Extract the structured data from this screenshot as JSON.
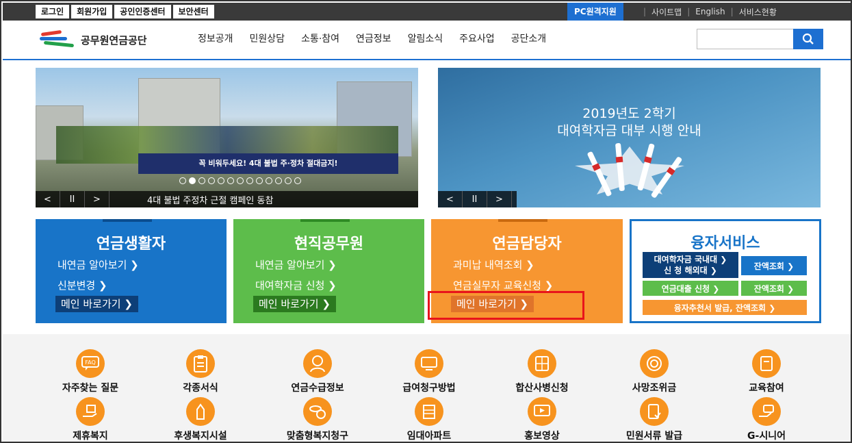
{
  "topbar": {
    "left": [
      "로그인",
      "회원가입",
      "공인인증센터",
      "보안센터"
    ],
    "pc": "PC원격지원",
    "right": [
      "사이트맵",
      "English",
      "서비스현황"
    ]
  },
  "header": {
    "org": "공무원연금공단",
    "gnb": [
      "정보공개",
      "민원상담",
      "소통·참여",
      "연금정보",
      "알림소식",
      "주요사업",
      "공단소개"
    ],
    "search_placeholder": ""
  },
  "banner1": {
    "slogan": "꼭 비워두세요! 4대 불법 주·정차 절대금지!",
    "caption": "4대 불법 주정차 근절 캠페인 동참",
    "controls": [
      "<",
      "II",
      ">"
    ]
  },
  "banner2": {
    "title1": "2019년도 2학기",
    "title2": "대여학자금 대부 시행 안내",
    "controls": [
      "<",
      "II",
      ">"
    ]
  },
  "cards": {
    "c1": {
      "title": "연금생활자",
      "l1": "내연금 알아보기 ❯",
      "l2": "신분변경 ❯",
      "go": "메인 바로가기 ❯"
    },
    "c2": {
      "title": "현직공무원",
      "l1": "내연금 알아보기 ❯",
      "l2": "대여학자금 신청 ❯",
      "go": "메인 바로가기 ❯"
    },
    "c3": {
      "title": "연금담당자",
      "l1": "과미납 내역조회 ❯",
      "l2": "연금실무자 교육신청 ❯",
      "go": "메인 바로가기 ❯"
    },
    "c4": {
      "title": "융자서비스",
      "r1a": "대여학자금 국내대 ❯",
      "r1b": "신 청 해외대 ❯",
      "r1c": "잔액조회 ❯",
      "r2a": "연금대출 신청 ❯",
      "r2c": "잔액조회 ❯",
      "r3": "융자추천서 발급, 잔액조회 ❯"
    }
  },
  "quick": {
    "row1": [
      "자주찾는 질문",
      "각종서식",
      "연금수급정보",
      "급여청구방법",
      "합산사병신청",
      "사망조위금",
      "교육참여"
    ],
    "row2": [
      "제휴복지",
      "후생복지시설",
      "맞춤형복지청구",
      "임대아파트",
      "홍보영상",
      "민원서류 발급",
      "G-시니어"
    ],
    "icons1": [
      "faq-icon",
      "clipboard-icon",
      "person-icon",
      "calculator-screen-icon",
      "calculator-icon",
      "coin-icon",
      "book-icon"
    ],
    "icons2": [
      "gift-hand-icon",
      "hand-money-icon",
      "coins-w-icon",
      "building-icon",
      "video-icon",
      "document-check-icon",
      "hand-card-icon"
    ]
  },
  "colors": {
    "blue": "#1874c8",
    "green": "#5dbd4b",
    "orange": "#f79631",
    "highlight": "#e8141b"
  }
}
